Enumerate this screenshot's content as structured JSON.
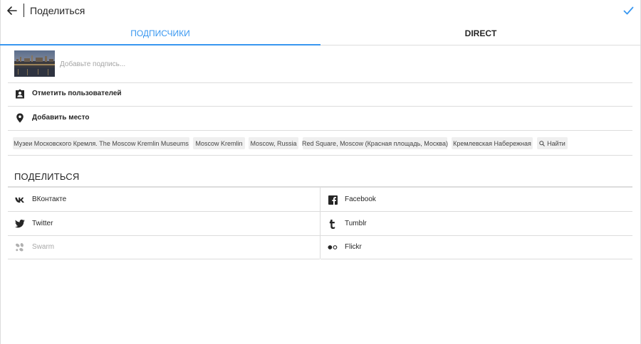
{
  "header": {
    "title": "Поделиться"
  },
  "tabs": [
    {
      "label": "ПОДПИСЧИКИ",
      "active": true
    },
    {
      "label": "DIRECT",
      "active": false
    }
  ],
  "caption": {
    "placeholder": "Добавьте подпись..."
  },
  "options": {
    "tag_users": "Отметить пользователей",
    "add_place": "Добавить место"
  },
  "locations": [
    "Музеи Московского Кремля. The Moscow Kremlin Museums",
    "Moscow Kremlin",
    "Moscow, Russia",
    "Red Square, Moscow (Красная площадь, Москва)",
    "Кремлевская Набережная"
  ],
  "location_search": "Найти",
  "share": {
    "heading": "ПОДЕЛИТЬСЯ",
    "services": [
      {
        "label": "ВКонтакте",
        "icon": "vk-icon",
        "enabled": true
      },
      {
        "label": "Facebook",
        "icon": "facebook-icon",
        "enabled": true
      },
      {
        "label": "Twitter",
        "icon": "twitter-icon",
        "enabled": true
      },
      {
        "label": "Tumblr",
        "icon": "tumblr-icon",
        "enabled": true
      },
      {
        "label": "Swarm",
        "icon": "swarm-icon",
        "enabled": false
      },
      {
        "label": "Flickr",
        "icon": "flickr-icon",
        "enabled": true
      }
    ]
  },
  "colors": {
    "accent": "#3897f0",
    "text": "#262626",
    "divider": "#dcdcdc",
    "chip_bg": "#efefef",
    "disabled_text": "#a8a8a8"
  }
}
